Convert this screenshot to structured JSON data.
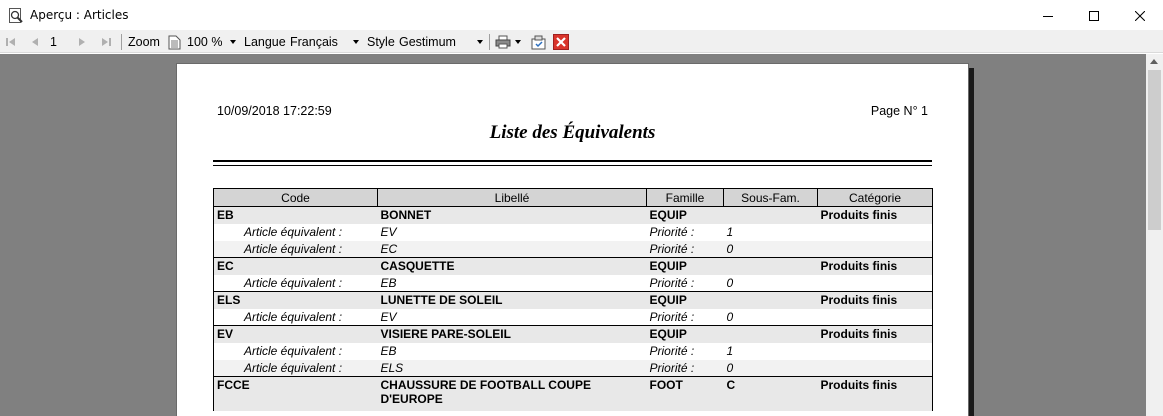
{
  "window": {
    "title": "Aperçu : Articles"
  },
  "toolbar": {
    "page_number": "1",
    "zoom_label": "Zoom",
    "zoom_value": "100 %",
    "language_label": "Langue",
    "language_value": "Français",
    "style_label": "Style",
    "style_value": "Gestimum"
  },
  "report": {
    "date": "10/09/2018 17:22:59",
    "page_label": "Page N° 1",
    "title": "Liste des Équivalents",
    "columns": [
      "Code",
      "Libellé",
      "Famille",
      "Sous-Fam.",
      "Catégorie"
    ],
    "equiv_label": "Article équivalent :",
    "priority_label": "Priorité :",
    "items": [
      {
        "code": "EB",
        "libelle": "BONNET",
        "famille": "EQUIP",
        "sous_famille": "",
        "categorie": "Produits finis",
        "equivalents": [
          {
            "article": "EV",
            "priorite": "1"
          },
          {
            "article": "EC",
            "priorite": "0"
          }
        ]
      },
      {
        "code": "EC",
        "libelle": "CASQUETTE",
        "famille": "EQUIP",
        "sous_famille": "",
        "categorie": "Produits finis",
        "equivalents": [
          {
            "article": "EB",
            "priorite": "0"
          }
        ]
      },
      {
        "code": "ELS",
        "libelle": "LUNETTE DE SOLEIL",
        "famille": "EQUIP",
        "sous_famille": "",
        "categorie": "Produits finis",
        "equivalents": [
          {
            "article": "EV",
            "priorite": "0"
          }
        ]
      },
      {
        "code": "EV",
        "libelle": "VISIERE PARE-SOLEIL",
        "famille": "EQUIP",
        "sous_famille": "",
        "categorie": "Produits finis",
        "equivalents": [
          {
            "article": "EB",
            "priorite": "1"
          },
          {
            "article": "ELS",
            "priorite": "0"
          }
        ]
      },
      {
        "code": "FCCE",
        "libelle": "CHAUSSURE DE FOOTBALL COUPE D'EUROPE",
        "famille": "FOOT",
        "sous_famille": "C",
        "categorie": "Produits finis",
        "equivalents": []
      }
    ]
  },
  "colors": {
    "preview_bg": "#808080",
    "header_bg": "#d4d4d4",
    "row_bg": "#e8e8e8",
    "close_red": "#d9342b"
  }
}
